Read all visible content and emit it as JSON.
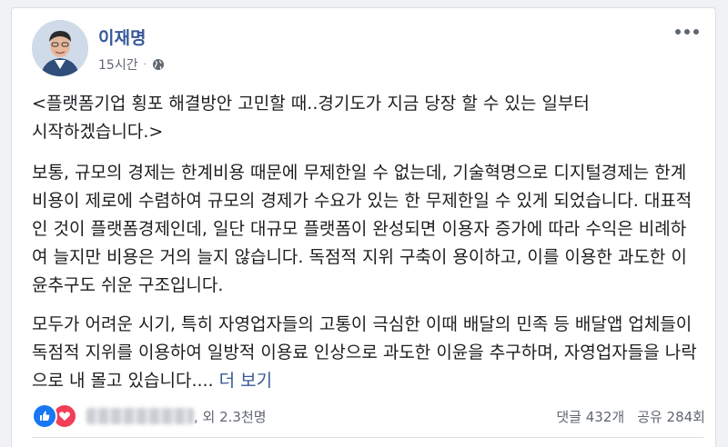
{
  "post": {
    "author_name": "이재명",
    "timestamp": "15시간",
    "separator": "·",
    "privacy_icon": "globe-icon",
    "more_icon": "more-options-icon",
    "title_line1": "<플랫폼기업 횡포 해결방안 고민할 때..경기도가 지금 당장 할 수 있는 일부터",
    "title_line2": "시작하겠습니다.>",
    "paragraph1": "보통, 규모의 경제는 한계비용 때문에 무제한일 수 없는데, 기술혁명으로 디지털경제는 한계비용이 제로에 수렴하여 규모의 경제가 수요가 있는 한 무제한일 수 있게 되었습니다. 대표적인 것이 플랫폼경제인데, 일단 대규모 플랫폼이 완성되면 이용자 증가에 따라 수익은 비례하여 늘지만 비용은 거의 늘지 않습니다. 독점적 지위 구축이 용이하고, 이를 이용한 과도한 이윤추구도 쉬운 구조입니다.",
    "paragraph2": "모두가 어려운 시기, 특히 자영업자들의 고통이 극심한 이때 배달의 민족 등 배달앱 업체들이 독점적 지위를 이용하여 일방적 이용료 인상으로 과도한 이윤을 추구하며, 자영업자들을 나락으로 내 몰고 있습니다....",
    "see_more": "더 보기"
  },
  "footer": {
    "reaction_icons": [
      "like-icon",
      "love-icon"
    ],
    "others_text": ", 외 2.3천명",
    "comments": "댓글 432개",
    "shares": "공유 284회"
  },
  "colors": {
    "author_link": "#385898",
    "like": "#1877f2",
    "love": "#f33e58",
    "secondary_text": "#606770"
  }
}
